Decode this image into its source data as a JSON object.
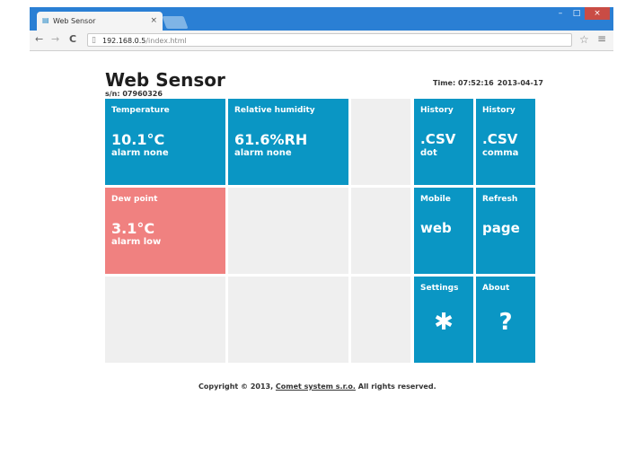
{
  "browser": {
    "tab_title": "Web Sensor",
    "tab_close": "×",
    "url_host": "192.168.0.5",
    "url_path": "/index.html",
    "back": "←",
    "forward": "→",
    "reload": "C",
    "star": "☆",
    "menu": "≡",
    "win_minimize": "–",
    "win_maximize": "□",
    "win_close": "×"
  },
  "header": {
    "title": "Web Sensor",
    "serial": "s/n: 07960326",
    "time_label": "Time: 07:52:16",
    "date": "2013-04-17"
  },
  "tiles": {
    "temperature": {
      "label": "Temperature",
      "value": "10.1°C",
      "alarm": "alarm none"
    },
    "humidity": {
      "label": "Relative humidity",
      "value": "61.6%RH",
      "alarm": "alarm none"
    },
    "dewpoint": {
      "label": "Dew point",
      "value": "3.1°C",
      "alarm": "alarm low"
    },
    "history_dot": {
      "label": "History",
      "value": ".CSV",
      "sub": "dot"
    },
    "history_comma": {
      "label": "History",
      "value": ".CSV",
      "sub": "comma"
    },
    "mobile": {
      "label": "Mobile",
      "value": "web"
    },
    "refresh": {
      "label": "Refresh",
      "value": "page"
    },
    "settings": {
      "label": "Settings",
      "value": "✱"
    },
    "about": {
      "label": "About",
      "value": "?"
    }
  },
  "footer": {
    "prefix": "Copyright © 2013,",
    "link": "Comet system s.r.o.",
    "suffix": "All rights reserved."
  },
  "colors": {
    "tile_blue": "#0a96c4",
    "tile_alarm": "#f08180",
    "tile_empty": "#efefef",
    "chrome_blue": "#2a7fd4"
  }
}
